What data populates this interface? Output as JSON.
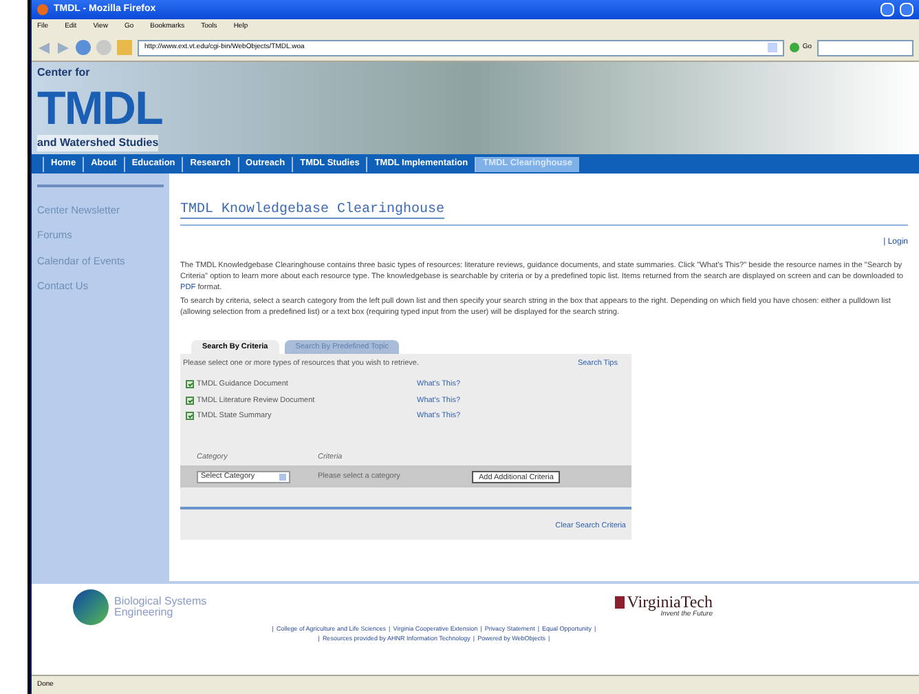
{
  "window": {
    "title": "TMDL - Mozilla Firefox"
  },
  "menu": [
    "File",
    "Edit",
    "View",
    "Go",
    "Bookmarks",
    "Tools",
    "Help"
  ],
  "toolbar": {
    "address": "http://www.ext.vt.edu/cgi-bin/WebObjects/TMDL.woa",
    "go": "Go"
  },
  "banner": {
    "top": "Center for",
    "logo": "TMDL",
    "bottom": "and Watershed Studies"
  },
  "nav": [
    {
      "label": "Home",
      "selected": false
    },
    {
      "label": "About",
      "selected": false
    },
    {
      "label": "Education",
      "selected": false
    },
    {
      "label": "Research",
      "selected": false
    },
    {
      "label": "Outreach",
      "selected": false
    },
    {
      "label": "TMDL Studies",
      "selected": false
    },
    {
      "label": "TMDL Implementation",
      "selected": false
    },
    {
      "label": "TMDL Clearinghouse",
      "selected": true
    }
  ],
  "sidebar": [
    "Center Newsletter",
    "Forums",
    "Calendar of Events",
    "Contact Us"
  ],
  "main": {
    "heading": "TMDL Knowledgebase Clearinghouse",
    "login": "| Login",
    "intro_before": "The TMDL Knowledgebase Clearinghouse contains three basic types of resources: literature reviews, guidance documents, and state summaries.  Click \"What's This?\" beside the resource names in the \"Search by Criteria\" option to learn more about each resource type.  The knowledgebase is searchable by criteria or by a predefined topic list.  Items returned from the search are displayed on screen and can be downloaded to",
    "intro_link": "PDF",
    "intro_after": "format.",
    "instructions": "To search by criteria, select a search category from the left pull down list and then specify your search string in the box that appears to the right.  Depending on which field you have chosen: either a pulldown list (allowing selection from a predefined list) or a text box (requiring typed input from the user) will be displayed for the search string."
  },
  "tabs": [
    {
      "label": "Search By Criteria",
      "selected": true
    },
    {
      "label": "Search By Predefined Topic",
      "selected": false
    }
  ],
  "panel": {
    "prompt": "Please select one or more types of resources that you wish to retrieve.",
    "tips": "Search Tips",
    "resources": [
      {
        "label": "TMDL Guidance Document",
        "checked": true,
        "link": "What's This?"
      },
      {
        "label": "TMDL Literature Review Document",
        "checked": true,
        "link": "What's This?"
      },
      {
        "label": "TMDL State Summary",
        "checked": true,
        "link": "What's This?"
      }
    ],
    "category_label": "Category",
    "criteria_label": "Criteria",
    "select": "Select Category",
    "criteria_text": "Please select a category",
    "add_button": "Add Additional Criteria",
    "clear": "Clear Search Criteria"
  },
  "footer": {
    "bse": [
      "Biological Systems",
      "Engineering"
    ],
    "vt": "VirginiaTech",
    "vt_tagline": "Invent the Future",
    "separator": "|",
    "lines": [
      [
        "College of Agriculture and Life Sciences",
        "Virginia Cooperative Extension",
        "Privacy Statement",
        "Equal Opportunity"
      ],
      [
        "Resources provided by AHNR Information Technology",
        "Powered by WebObjects"
      ]
    ]
  },
  "status_bar": "Done"
}
